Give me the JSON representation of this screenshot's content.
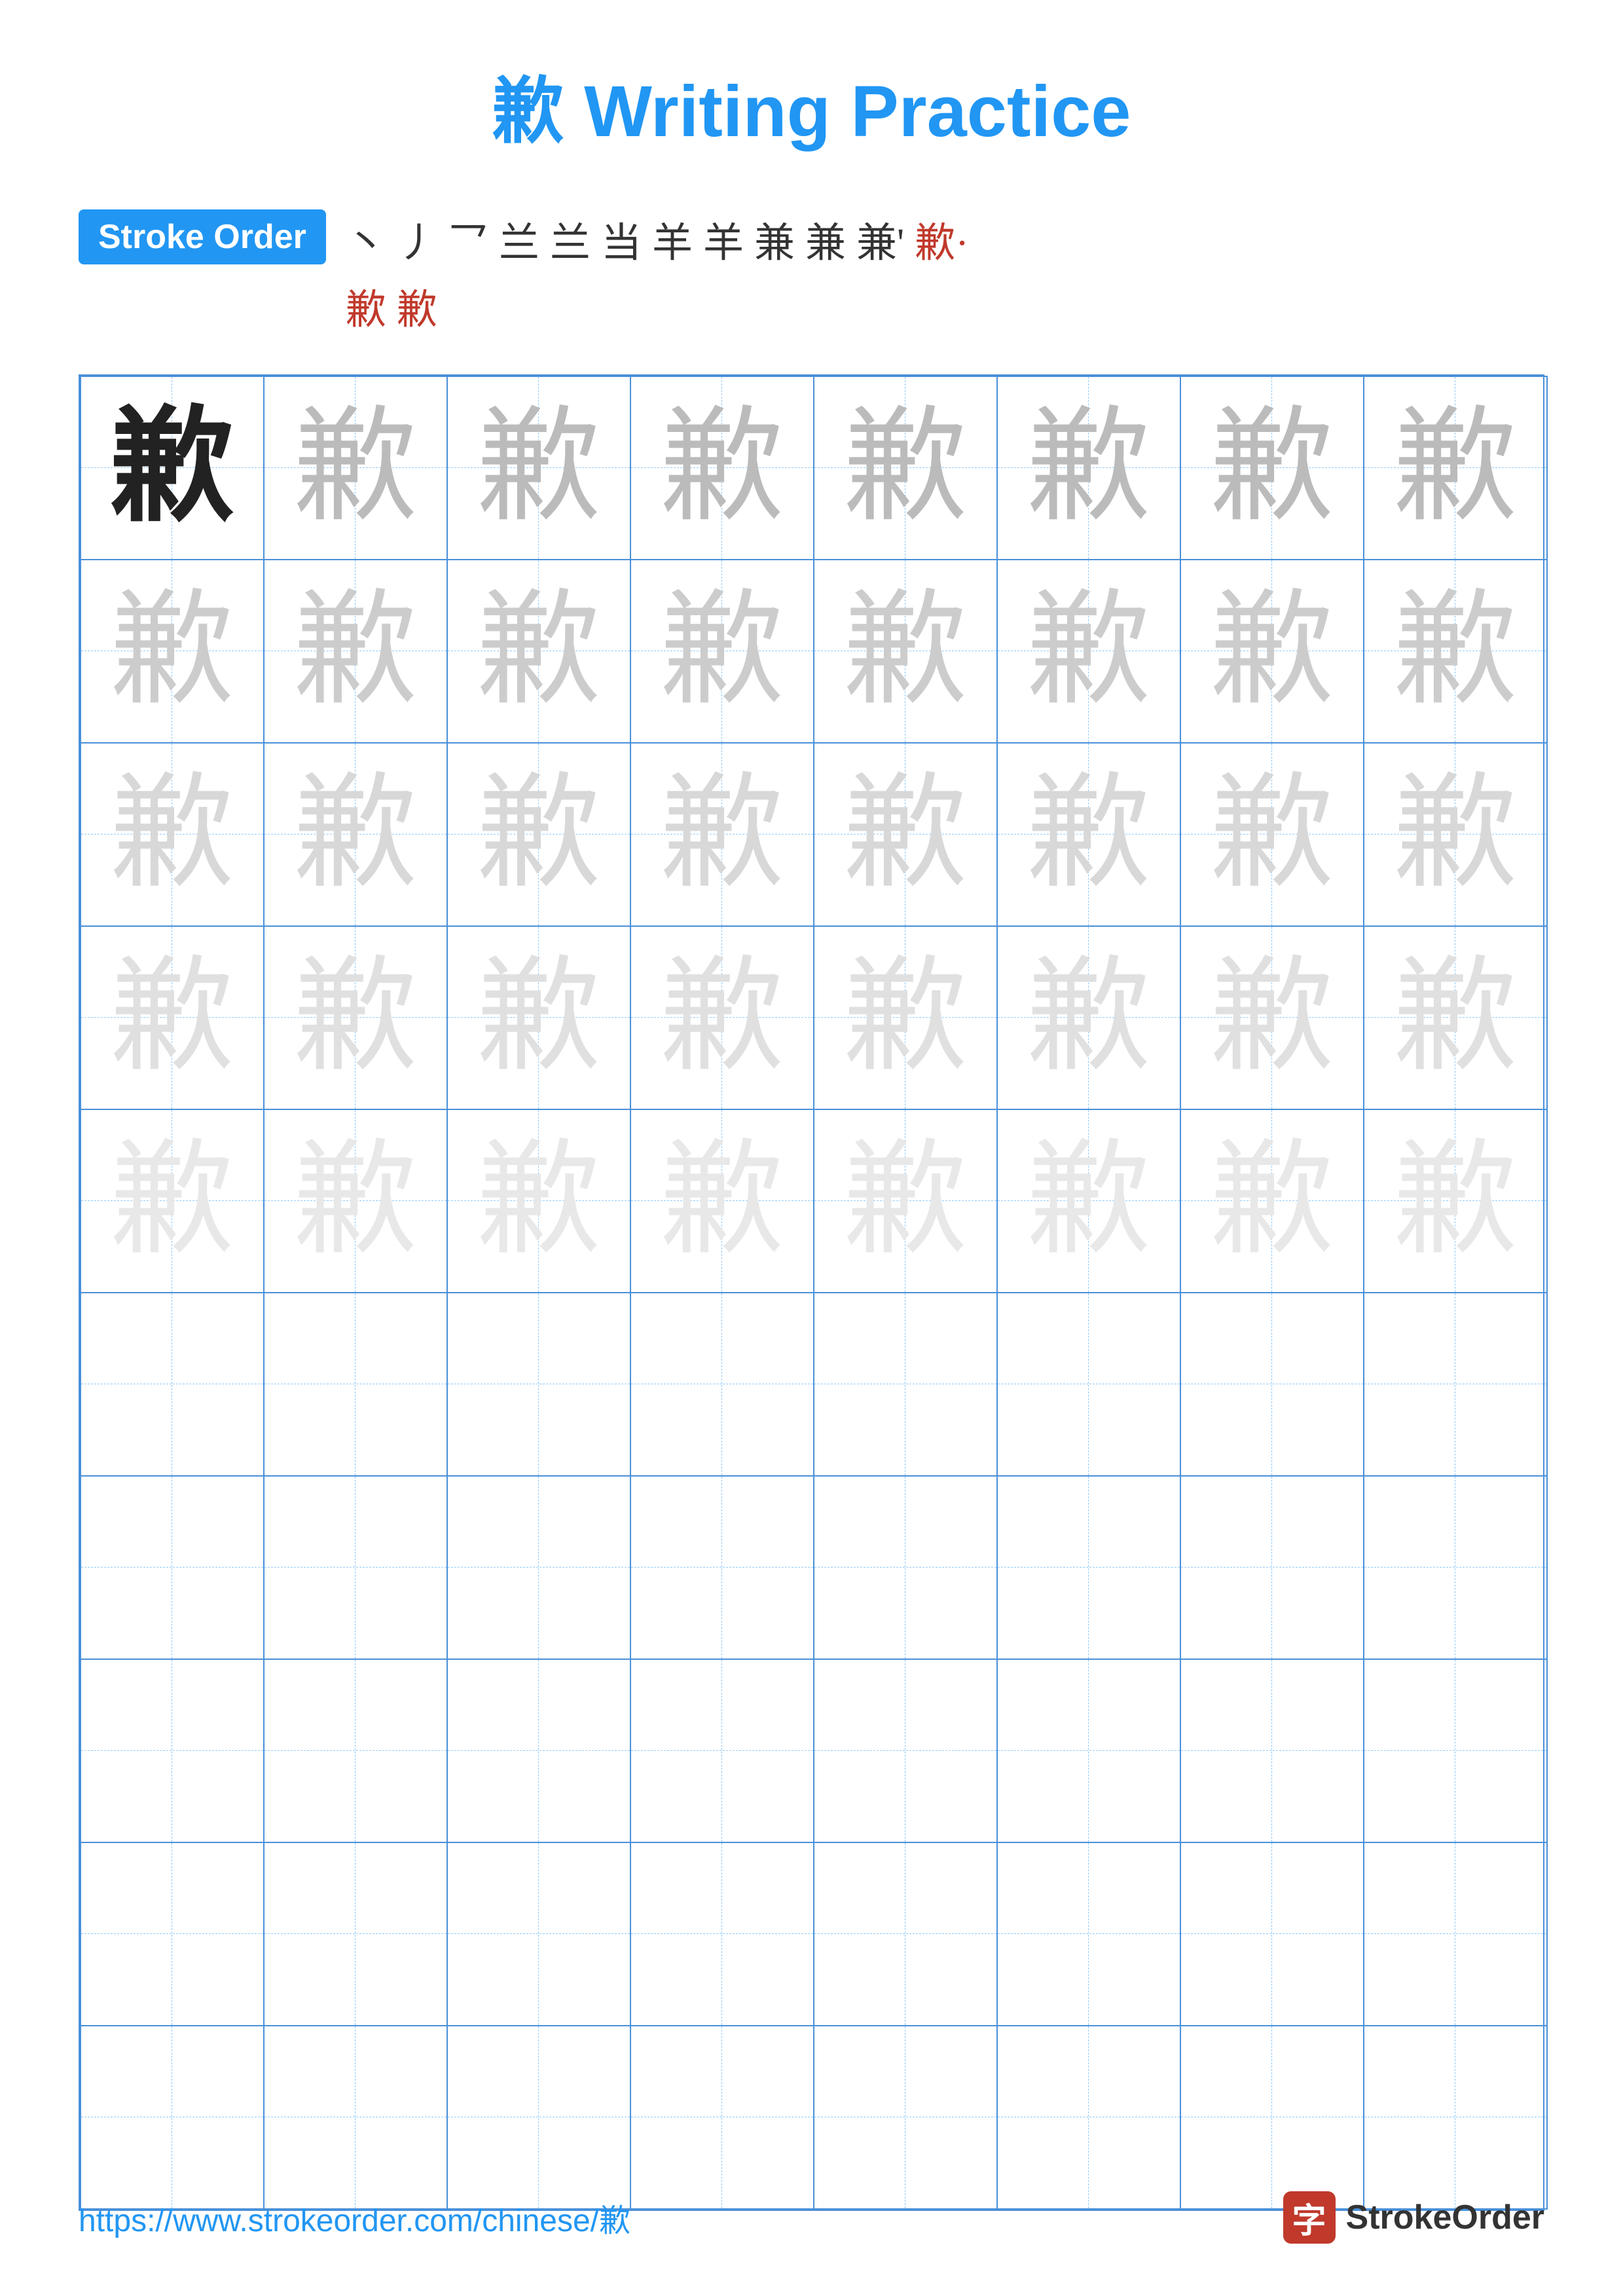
{
  "title": {
    "char": "歉",
    "label": "Writing Practice"
  },
  "stroke_order": {
    "badge_label": "Stroke Order",
    "strokes": [
      "丶",
      "丿",
      "乛",
      "兰",
      "兰",
      "当",
      "羊",
      "羊",
      "兼",
      "兼",
      "兼'",
      "歉·",
      "歉",
      "歉"
    ]
  },
  "grid": {
    "char": "歉",
    "rows": 10,
    "cols": 8
  },
  "footer": {
    "url": "https://www.strokeorder.com/chinese/歉",
    "logo_char": "字",
    "logo_name": "StrokeOrder"
  }
}
